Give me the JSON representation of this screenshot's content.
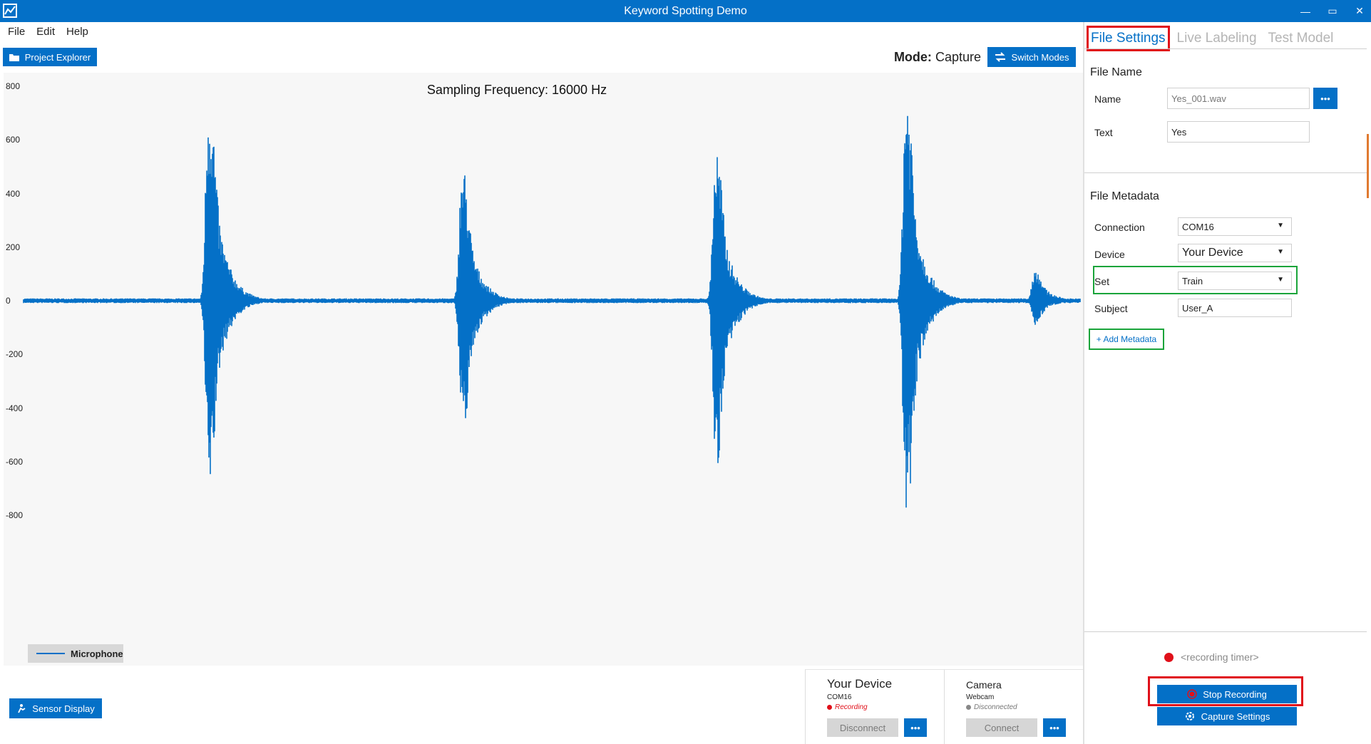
{
  "window": {
    "title": "Keyword Spotting Demo",
    "controls": [
      "—",
      "▭",
      "✕"
    ]
  },
  "menu": [
    "File",
    "Edit",
    "Help"
  ],
  "toolbar": {
    "project_explorer": "Project Explorer",
    "mode_label": "Mode:",
    "mode_value": "Capture",
    "switch_modes": "Switch Modes"
  },
  "chart_data": {
    "type": "line",
    "title": "Sampling Frequency: 16000 Hz",
    "y_ticks": [
      "800",
      "600",
      "400",
      "200",
      "0",
      "-200",
      "-400",
      "-600",
      "-800"
    ],
    "ylim": [
      -800,
      800
    ],
    "series": [
      {
        "name": "Microphone",
        "color": "#0470c7",
        "bursts": [
          {
            "center_frac": 0.175,
            "max": 800,
            "min": -700
          },
          {
            "center_frac": 0.415,
            "max": 500,
            "min": -480
          },
          {
            "center_frac": 0.655,
            "max": 570,
            "min": -620
          },
          {
            "center_frac": 0.835,
            "max": 810,
            "min": -800
          },
          {
            "center_frac": 0.957,
            "max": 120,
            "min": -90
          }
        ]
      }
    ],
    "legend": "bottom-left"
  },
  "bottom": {
    "sensor_display": "Sensor Display"
  },
  "devices": [
    {
      "name": "Your Device",
      "port": "COM16",
      "status": "Recording",
      "status_color": "#e0101a",
      "button": "Disconnect",
      "more": "•••"
    },
    {
      "name": "Camera",
      "port": "Webcam",
      "status": "Disconnected",
      "status_color": "#888888",
      "button": "Connect",
      "more": "•••"
    }
  ],
  "panel": {
    "tabs": [
      "File Settings",
      "Live Labeling",
      "Test Model"
    ],
    "file_name_title": "File Name",
    "name_label": "Name",
    "name_value": "Yes_001.wav",
    "name_more": "•••",
    "text_label": "Text",
    "text_value": "Yes",
    "metadata_title": "File Metadata",
    "connection_label": "Connection",
    "connection_value": "COM16",
    "device_label": "Device",
    "device_value": "Your Device",
    "set_label": "Set",
    "set_value": "Train",
    "subject_label": "Subject",
    "subject_value": "User_A",
    "add_metadata": "+ Add Metadata",
    "recording_timer": "<recording timer>",
    "stop_recording": "Stop Recording",
    "capture_settings": "Capture Settings"
  }
}
